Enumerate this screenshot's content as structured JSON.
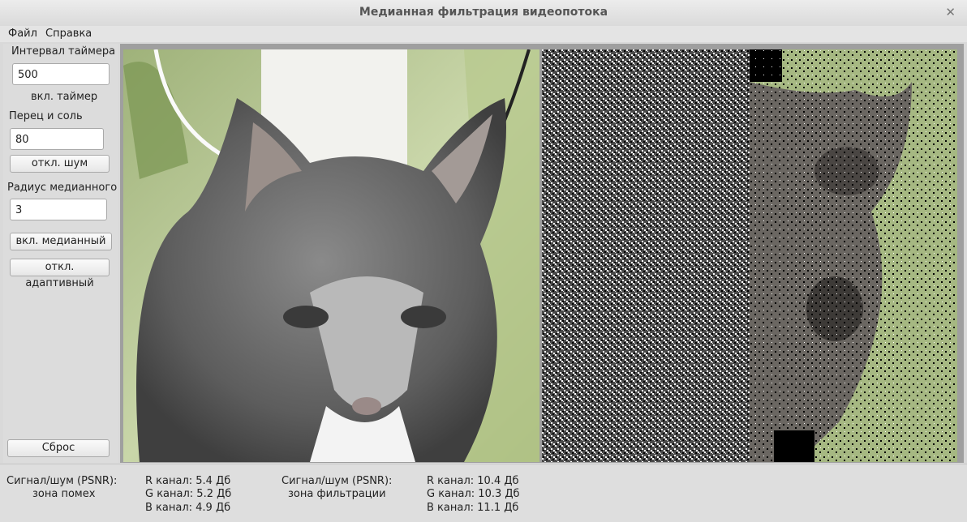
{
  "window": {
    "title": "Медианная фильтрация видеопотока"
  },
  "menu": {
    "file": "Файл",
    "help": "Справка"
  },
  "controls": {
    "timer_label": "Интервал таймера",
    "timer_value": "500",
    "timer_checkbox": "вкл. таймер",
    "noise_label": "Перец и соль",
    "noise_value": "80",
    "noise_button": "откл. шум",
    "median_label": "Радиус медианного",
    "median_value": "3",
    "median_button": "вкл. медианный",
    "adaptive_button": "откл. адаптивный",
    "reset_button": "Сброс"
  },
  "status": {
    "left_title": "Сигнал/шум (PSNR):",
    "left_zone": "зона помех",
    "left_r": "R канал: 5.4 Дб",
    "left_g": "G канал: 5.2 Дб",
    "left_b": "B канал: 4.9 Дб",
    "right_title": "Сигнал/шум (PSNR):",
    "right_zone": "зона фильтрации",
    "right_r": "R канал: 10.4 Дб",
    "right_g": "G канал: 10.3 Дб",
    "right_b": "B канал: 11.1 Дб"
  },
  "images": {
    "original": "cat-photo",
    "noisy": "salt-pepper-noise",
    "filtered": "filtered-cat"
  }
}
